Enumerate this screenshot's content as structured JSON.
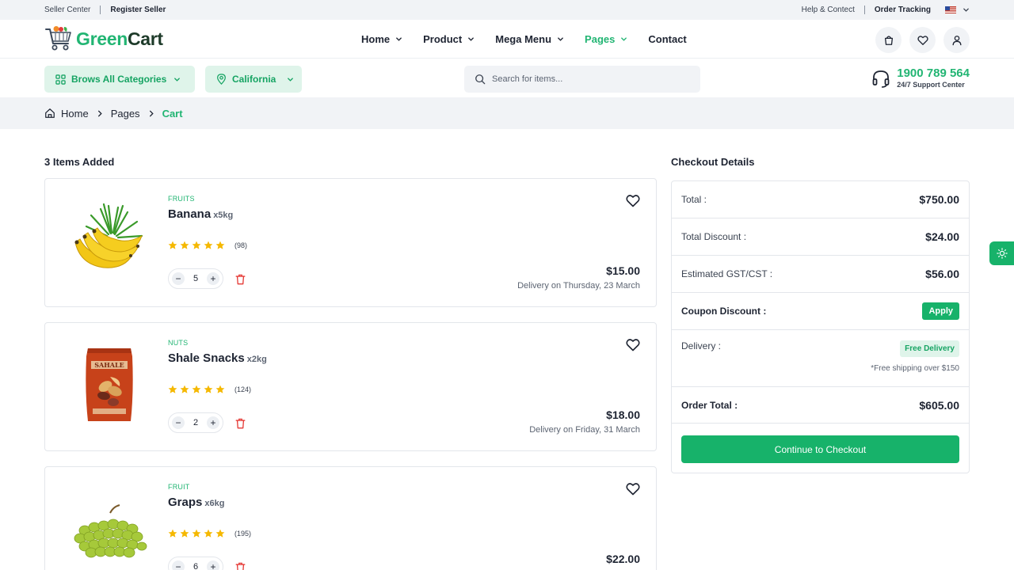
{
  "topbar": {
    "seller_center": "Seller Center",
    "register_seller": "Register Seller",
    "help": "Help & Contect",
    "order_tracking": "Order Tracking"
  },
  "brand": {
    "name_part1": "Green",
    "name_part2": "Cart"
  },
  "nav": {
    "items": [
      {
        "label": "Home"
      },
      {
        "label": "Product"
      },
      {
        "label": "Mega Menu"
      },
      {
        "label": "Pages"
      },
      {
        "label": "Contact"
      }
    ]
  },
  "toolbar": {
    "categories_label": "Brows All Categories",
    "location_label": "California",
    "search_placeholder": "Search for items...",
    "support_phone": "1900 789 564",
    "support_sub": "24/7 Support Center"
  },
  "breadcrumb": {
    "home": "Home",
    "pages": "Pages",
    "current": "Cart"
  },
  "cart": {
    "title": "3 Items Added",
    "items": [
      {
        "category": "FRUITS",
        "name": "Banana",
        "unit": "x5kg",
        "rating_count": "(98)",
        "quantity": "5",
        "price": "$15.00",
        "delivery": "Delivery on Thursday, 23 March"
      },
      {
        "category": "NUTS",
        "name": "Shale Snacks",
        "unit": "x2kg",
        "rating_count": "(124)",
        "quantity": "2",
        "price": "$18.00",
        "delivery": "Delivery on Friday, 31 March"
      },
      {
        "category": "FRUIT",
        "name": "Graps",
        "unit": "x6kg",
        "rating_count": "(195)",
        "quantity": "6",
        "price": "$22.00",
        "delivery": ""
      }
    ]
  },
  "checkout": {
    "title": "Checkout Details",
    "total_label": "Total :",
    "total_value": "$750.00",
    "discount_label": "Total Discount :",
    "discount_value": "$24.00",
    "gst_label": "Estimated GST/CST :",
    "gst_value": "$56.00",
    "coupon_label": "Coupon Discount :",
    "apply_label": "Apply",
    "delivery_label": "Delivery :",
    "delivery_badge": "Free Delivery",
    "delivery_note": "*Free shipping over $150",
    "order_total_label": "Order Total :",
    "order_total_value": "$605.00",
    "cta_label": "Continue to Checkout"
  },
  "colors": {
    "accent": "#22b573",
    "button": "#17b26a",
    "star": "#f5b800",
    "danger": "#e53935"
  },
  "icons": [
    "cart-icon",
    "heart-icon",
    "user-icon",
    "grid-icon",
    "location-icon",
    "search-icon",
    "headset-icon",
    "home-icon",
    "star-icon",
    "trash-icon",
    "sun-icon"
  ]
}
